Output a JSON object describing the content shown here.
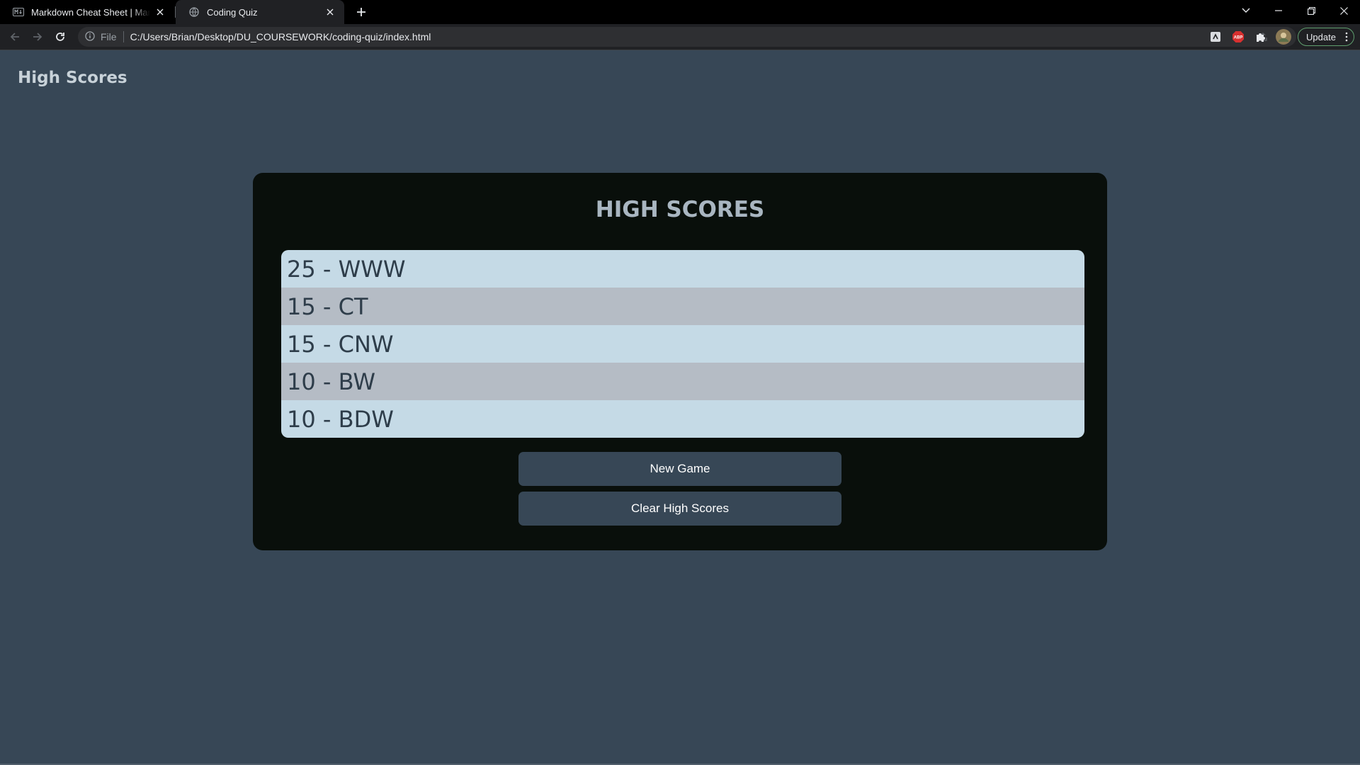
{
  "browser": {
    "tabs": [
      {
        "title": "Markdown Cheat Sheet | Markdown Guide",
        "favicon": "markdown-icon",
        "active": false
      },
      {
        "title": "Coding Quiz",
        "favicon": "globe-icon",
        "active": true
      }
    ],
    "address": {
      "scheme_label": "File",
      "url": "C:/Users/Brian/Desktop/DU_COURSEWORK/coding-quiz/index.html"
    },
    "update_label": "Update",
    "extensions": [
      "reader-extension-icon",
      "adblock-icon",
      "extensions-puzzle-icon",
      "profile-avatar"
    ],
    "colors": {
      "tabstrip": "#000000",
      "toolbar": "#202124",
      "update_border": "#5f9e6e"
    }
  },
  "page": {
    "nav_link": "High Scores",
    "card": {
      "title": "HIGH SCORES",
      "scores": [
        {
          "text": "25 - WWW"
        },
        {
          "text": "15 - CT"
        },
        {
          "text": "15 - CNW"
        },
        {
          "text": "10 - BW"
        },
        {
          "text": "10 - BDW"
        }
      ],
      "buttons": {
        "new_game": "New Game",
        "clear": "Clear High Scores"
      }
    },
    "colors": {
      "background": "#374756",
      "card": "#090f0b",
      "row_light": "#c5dae6",
      "row_dark": "#b5bcc5",
      "button": "#374756"
    }
  }
}
